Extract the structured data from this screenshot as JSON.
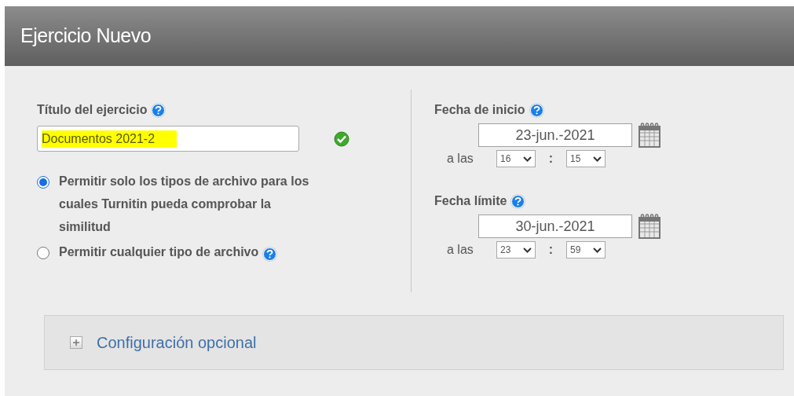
{
  "header": {
    "title": "Ejercicio Nuevo"
  },
  "title_field": {
    "label": "Título del ejercicio",
    "value": "Documentos 2021-2",
    "highlighted": true,
    "valid": true
  },
  "file_types": [
    {
      "label": "Permitir solo los tipos de archivo para los cuales Turnitin pueda comprobar la similitud",
      "selected": true,
      "help": false
    },
    {
      "label": "Permitir cualquier tipo de archivo",
      "selected": false,
      "help": true
    }
  ],
  "dates": [
    {
      "label": "Fecha de inicio",
      "date": "23-jun.-2021",
      "at": "a las",
      "hour": "16",
      "separator": ":",
      "minute": "15"
    },
    {
      "label": "Fecha límite",
      "date": "30-jun.-2021",
      "at": "a las",
      "hour": "23",
      "separator": ":",
      "minute": "59"
    }
  ],
  "optional_section": {
    "label": "Configuración opcional",
    "expanded": false
  }
}
